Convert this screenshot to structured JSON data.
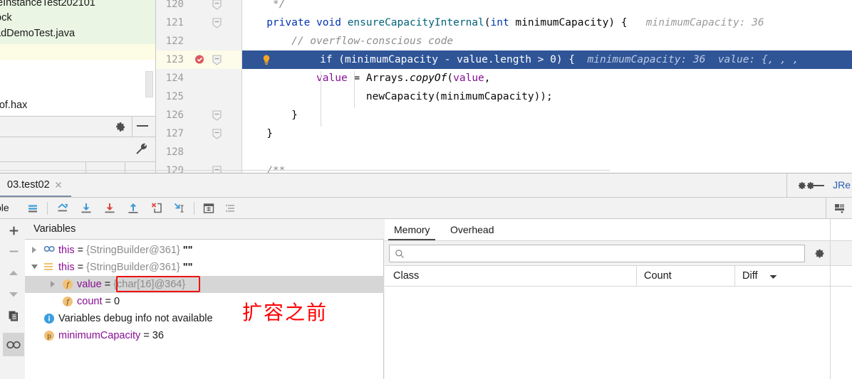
{
  "project_panel": {
    "rows": [
      "eInstanceTest202101",
      "ock",
      "adDemoTest.java",
      "rof.hax"
    ],
    "icons": [
      "gear-icon",
      "minimize-icon",
      "wrench-icon"
    ]
  },
  "editor": {
    "lines": [
      {
        "num": "120",
        "fold": true,
        "breakpoint": false,
        "highlighted": false,
        "selected": false,
        "segments": [
          {
            "t": "    */",
            "c": "cmt"
          }
        ]
      },
      {
        "num": "121",
        "fold": true,
        "breakpoint": false,
        "highlighted": false,
        "selected": false,
        "segments": [
          {
            "t": "   ",
            "c": "pln"
          },
          {
            "t": "private",
            "c": "kw"
          },
          {
            "t": " ",
            "c": "pln"
          },
          {
            "t": "void",
            "c": "kw"
          },
          {
            "t": " ",
            "c": "pln"
          },
          {
            "t": "ensureCapacityInternal",
            "c": "mth"
          },
          {
            "t": "(",
            "c": "pln"
          },
          {
            "t": "int",
            "c": "kw"
          },
          {
            "t": " minimumCapacity) {",
            "c": "pln"
          },
          {
            "t": "   minimumCapacity: 36",
            "c": "hint"
          }
        ]
      },
      {
        "num": "122",
        "fold": false,
        "breakpoint": false,
        "highlighted": false,
        "selected": false,
        "segments": [
          {
            "t": "       // overflow-conscious code",
            "c": "cmt"
          }
        ]
      },
      {
        "num": "123",
        "fold": true,
        "breakpoint": true,
        "highlighted": true,
        "selected": true,
        "segments": [
          {
            "t": "       ",
            "c": "pln"
          },
          {
            "t": "if",
            "c": "kw"
          },
          {
            "t": " (minimumCapacity - value.length > 0) {",
            "c": "pln"
          },
          {
            "t": "  minimumCapacity: 36  value: {, , ,",
            "c": "hint"
          }
        ]
      },
      {
        "num": "124",
        "fold": false,
        "breakpoint": false,
        "highlighted": false,
        "selected": false,
        "segments": [
          {
            "t": "           ",
            "c": "pln"
          },
          {
            "t": "value",
            "c": "fld"
          },
          {
            "t": " = Arrays.",
            "c": "pln"
          },
          {
            "t": "copyOf",
            "c": "ita"
          },
          {
            "t": "(",
            "c": "pln"
          },
          {
            "t": "value",
            "c": "fld"
          },
          {
            "t": ",",
            "c": "pln"
          }
        ]
      },
      {
        "num": "125",
        "fold": false,
        "breakpoint": false,
        "highlighted": false,
        "selected": false,
        "segments": [
          {
            "t": "                   newCapacity(minimumCapacity));",
            "c": "pln"
          }
        ]
      },
      {
        "num": "126",
        "fold": true,
        "breakpoint": false,
        "highlighted": false,
        "selected": false,
        "segments": [
          {
            "t": "       }",
            "c": "pln"
          }
        ]
      },
      {
        "num": "127",
        "fold": true,
        "breakpoint": false,
        "highlighted": false,
        "selected": false,
        "segments": [
          {
            "t": "   }",
            "c": "pln"
          }
        ]
      },
      {
        "num": "128",
        "fold": false,
        "breakpoint": false,
        "highlighted": false,
        "selected": false,
        "segments": [
          {
            "t": "",
            "c": "pln"
          }
        ]
      },
      {
        "num": "129",
        "fold": true,
        "breakpoint": false,
        "highlighted": false,
        "selected": false,
        "segments": [
          {
            "t": "   /**",
            "c": "cmt"
          }
        ]
      }
    ]
  },
  "debug": {
    "tab_label": "03.test02",
    "close_icon": "close-icon",
    "gear_icon": "gear-icon",
    "minimize_icon": "minimize-icon",
    "jre_label": "JRe",
    "toolbar": {
      "left_label": "ole",
      "buttons": [
        "show-execution-point-icon",
        "step-over-icon",
        "step-into-icon",
        "force-step-into-icon",
        "step-out-icon",
        "drop-frame-icon",
        "run-to-cursor-icon",
        "evaluate-expression-icon",
        "settings-list-icon"
      ],
      "right_button": "layout-settings-icon"
    },
    "side_buttons": [
      "add-watch-icon",
      "remove-watch-icon",
      "move-up-icon",
      "move-down-icon",
      "copy-icon",
      "watches-icon"
    ],
    "variables": {
      "header": "Variables",
      "rows": [
        {
          "indent": 0,
          "arrow": "collapsed",
          "icon": "infinity-icon",
          "name": "this",
          "eq": " = ",
          "value": "{StringBuilder@361}",
          "suffix": " \"\"",
          "selected": false
        },
        {
          "indent": 0,
          "arrow": "expanded",
          "icon": "list-icon",
          "name": "this",
          "eq": " = ",
          "value": "{StringBuilder@361}",
          "suffix": " \"\"",
          "selected": false
        },
        {
          "indent": 1,
          "arrow": "collapsed",
          "icon": "field-icon",
          "name": "value",
          "eq": " = ",
          "value": "{char[16]@364}",
          "suffix": "",
          "selected": true,
          "boxed": true
        },
        {
          "indent": 1,
          "arrow": "none",
          "icon": "field-icon",
          "name": "count",
          "eq": " = ",
          "value": "0",
          "suffix": "",
          "selected": false,
          "numeric": true
        },
        {
          "indent": 0,
          "arrow": "none",
          "icon": "info-icon",
          "name": "",
          "eq": "",
          "value": "Variables debug info not available",
          "suffix": "",
          "selected": false,
          "plain": true
        },
        {
          "indent": 0,
          "arrow": "none",
          "icon": "param-icon",
          "name": "minimumCapacity",
          "eq": " = ",
          "value": "36",
          "suffix": "",
          "selected": false,
          "numeric": true
        }
      ],
      "annotation": "扩容之前",
      "annotation_color": "#ff0000",
      "highlight_box_color": "#ee1111"
    },
    "memory": {
      "tabs": [
        {
          "label": "Memory",
          "active": true
        },
        {
          "label": "Overhead",
          "active": false
        }
      ],
      "search_placeholder": "",
      "search_icon": "search-icon",
      "gear_icon": "gear-icon",
      "columns": [
        {
          "label": "Class",
          "sort": false
        },
        {
          "label": "Count",
          "sort": false
        },
        {
          "label": "Diff",
          "sort": true,
          "sort_icon": "chevron-down-icon"
        }
      ],
      "rows": []
    }
  },
  "colors": {
    "selection_blue": "#2f5597",
    "keyword_blue": "#0033b3",
    "method_teal": "#00627a",
    "field_purple": "#871094",
    "comment_gray": "#8c8c8c",
    "gutter_bg": "#f2f2f2",
    "panel_bg": "#f2f2f2",
    "tree_green": "#eaf5e4",
    "tree_yellow": "#fdfce4"
  }
}
